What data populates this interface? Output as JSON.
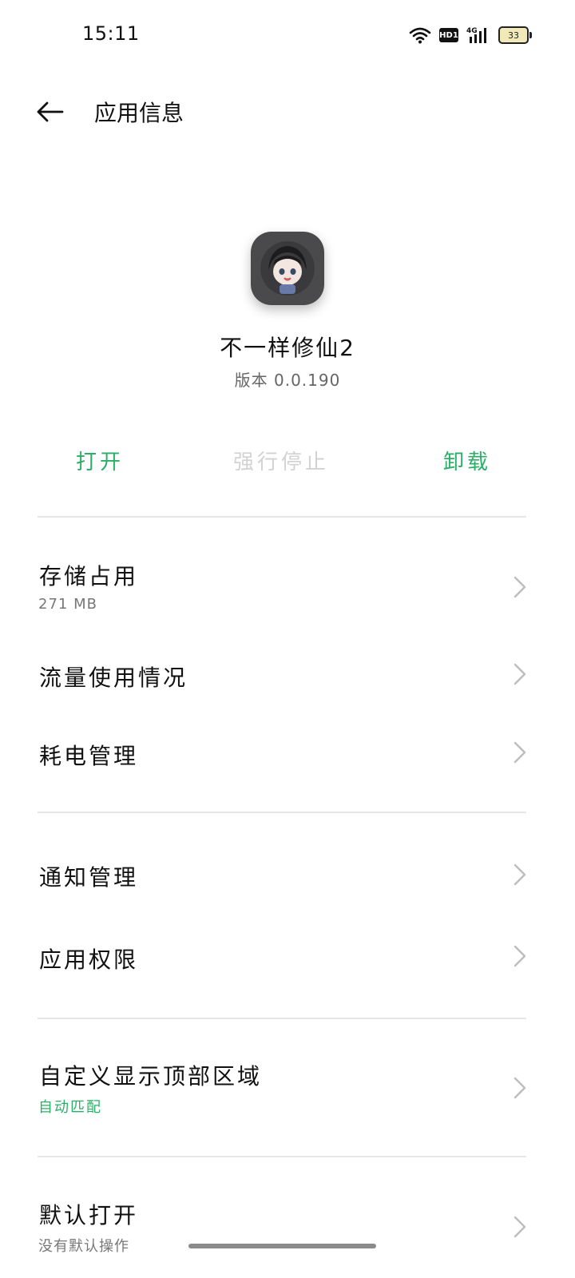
{
  "status_bar": {
    "time": "15:11",
    "network": "4G",
    "hd": "HD1",
    "battery": "33"
  },
  "header": {
    "title": "应用信息"
  },
  "app": {
    "name": "不一样修仙2",
    "version": "版本 0.0.190"
  },
  "actions": {
    "open": "打开",
    "force_stop": "强行停止",
    "uninstall": "卸载"
  },
  "colors": {
    "accent": "#2bae66",
    "disabled": "#d2d2d2"
  },
  "items": [
    {
      "title": "存储占用",
      "subtitle": "271 MB"
    },
    {
      "title": "流量使用情况"
    },
    {
      "title": "耗电管理"
    },
    {
      "title": "通知管理"
    },
    {
      "title": "应用权限"
    },
    {
      "title": "自定义显示顶部区域",
      "subtitle": "自动匹配"
    },
    {
      "title": "默认打开",
      "subtitle": "没有默认操作"
    }
  ]
}
